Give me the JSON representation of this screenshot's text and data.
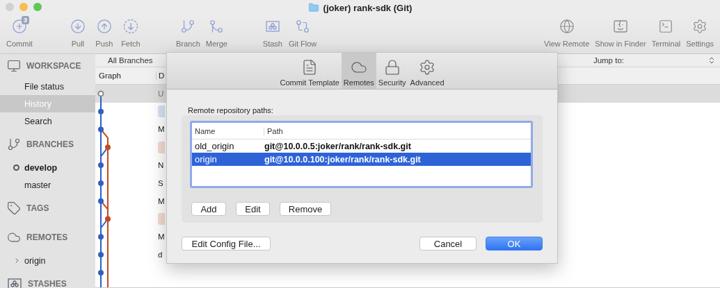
{
  "window": {
    "title": "(joker) rank-sdk (Git)"
  },
  "toolbar": {
    "groups": [
      [
        {
          "label": "Commit",
          "badge": "3"
        }
      ],
      [
        {
          "label": "Pull"
        },
        {
          "label": "Push"
        },
        {
          "label": "Fetch"
        }
      ],
      [
        {
          "label": "Branch"
        },
        {
          "label": "Merge"
        }
      ],
      [
        {
          "label": "Stash"
        },
        {
          "label": "Git Flow"
        }
      ]
    ],
    "right": [
      {
        "label": "View Remote"
      },
      {
        "label": "Show in Finder"
      },
      {
        "label": "Terminal"
      },
      {
        "label": "Settings"
      }
    ]
  },
  "sidebar": {
    "sections": [
      {
        "title": "WORKSPACE",
        "items": [
          {
            "label": "File status",
            "selected": false
          },
          {
            "label": "History",
            "selected": true
          },
          {
            "label": "Search",
            "selected": false
          }
        ]
      },
      {
        "title": "BRANCHES",
        "items": [
          {
            "label": "develop",
            "current": true
          },
          {
            "label": "master",
            "current": false
          }
        ]
      },
      {
        "title": "TAGS"
      },
      {
        "title": "REMOTES",
        "items": [
          {
            "label": "origin",
            "expanded": false
          }
        ]
      },
      {
        "title": "STASHES"
      }
    ]
  },
  "history": {
    "filter": "All Branches",
    "jump_label": "Jump to:",
    "columns": [
      "Graph",
      "D"
    ],
    "rows": [
      {
        "kind": "uncommitted",
        "text": "U"
      },
      {
        "kind": "tag",
        "color": "#d7e3f7"
      },
      {
        "kind": "text",
        "text": "M"
      },
      {
        "kind": "tag",
        "color": "#f4dbd3"
      },
      {
        "kind": "text",
        "text": "N"
      },
      {
        "kind": "text",
        "text": "S"
      },
      {
        "kind": "text",
        "text": "M"
      },
      {
        "kind": "tag",
        "color": "#f4dbd3"
      },
      {
        "kind": "text",
        "text": "M"
      },
      {
        "kind": "text",
        "text": "d"
      }
    ]
  },
  "dialog": {
    "tabs": [
      {
        "label": "Commit Template",
        "selected": false
      },
      {
        "label": "Remotes",
        "selected": true
      },
      {
        "label": "Security",
        "selected": false
      },
      {
        "label": "Advanced",
        "selected": false
      }
    ],
    "section_label": "Remote repository paths:",
    "table": {
      "columns": [
        "Name",
        "Path"
      ],
      "rows": [
        {
          "name": "old_origin",
          "path": "git@10.0.0.5:joker/rank/rank-sdk.git",
          "selected": false
        },
        {
          "name": "origin",
          "path": "git@10.0.0.100:joker/rank/rank-sdk.git",
          "selected": true
        }
      ]
    },
    "row_buttons": [
      "Add",
      "Edit",
      "Remove"
    ],
    "config_button": "Edit Config File...",
    "buttons": [
      {
        "label": "Cancel",
        "kind": "default"
      },
      {
        "label": "OK",
        "kind": "primary"
      }
    ]
  }
}
